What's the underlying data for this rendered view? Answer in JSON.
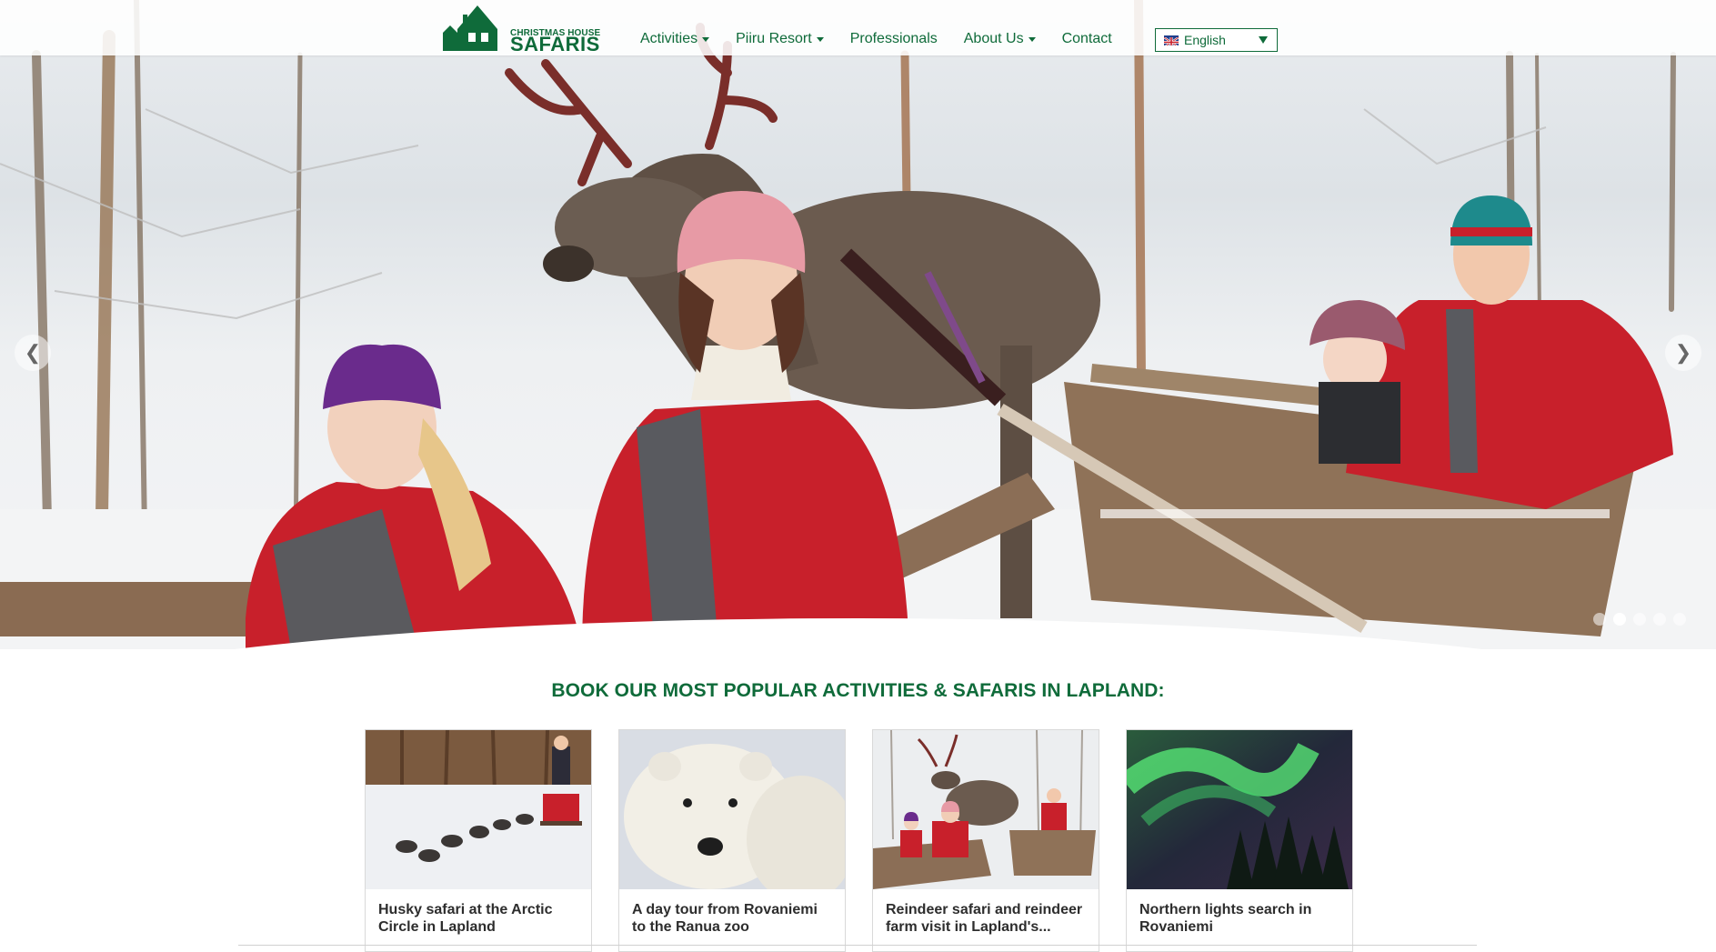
{
  "header": {
    "logo": {
      "top_text": "CHRISTMAS HOUSE",
      "main_text": "SAFARIS"
    },
    "nav": [
      {
        "label": "Activities",
        "dropdown": true
      },
      {
        "label": "Piiru Resort",
        "dropdown": true
      },
      {
        "label": "Professionals",
        "dropdown": false
      },
      {
        "label": "About Us",
        "dropdown": true
      },
      {
        "label": "Contact",
        "dropdown": false
      }
    ],
    "language": {
      "selected": "English",
      "flag": "uk-flag-icon"
    }
  },
  "hero": {
    "prev_icon": "chevron-left-icon",
    "next_icon": "chevron-right-icon",
    "slides_count": 5,
    "active_slide": 2
  },
  "section": {
    "title": "BOOK OUR MOST POPULAR ACTIVITIES & SAFARIS IN LAPLAND:"
  },
  "cards": [
    {
      "title": "Husky safari at the Arctic Circle in Lapland"
    },
    {
      "title": "A day tour from Rovaniemi to the Ranua zoo"
    },
    {
      "title": "Reindeer safari and reindeer farm visit in Lapland's..."
    },
    {
      "title": "Northern lights search in Rovaniemi"
    }
  ],
  "colors": {
    "brand": "#0f6b3a",
    "card_text": "#2d2d2d",
    "jacket_red": "#c8202b"
  }
}
